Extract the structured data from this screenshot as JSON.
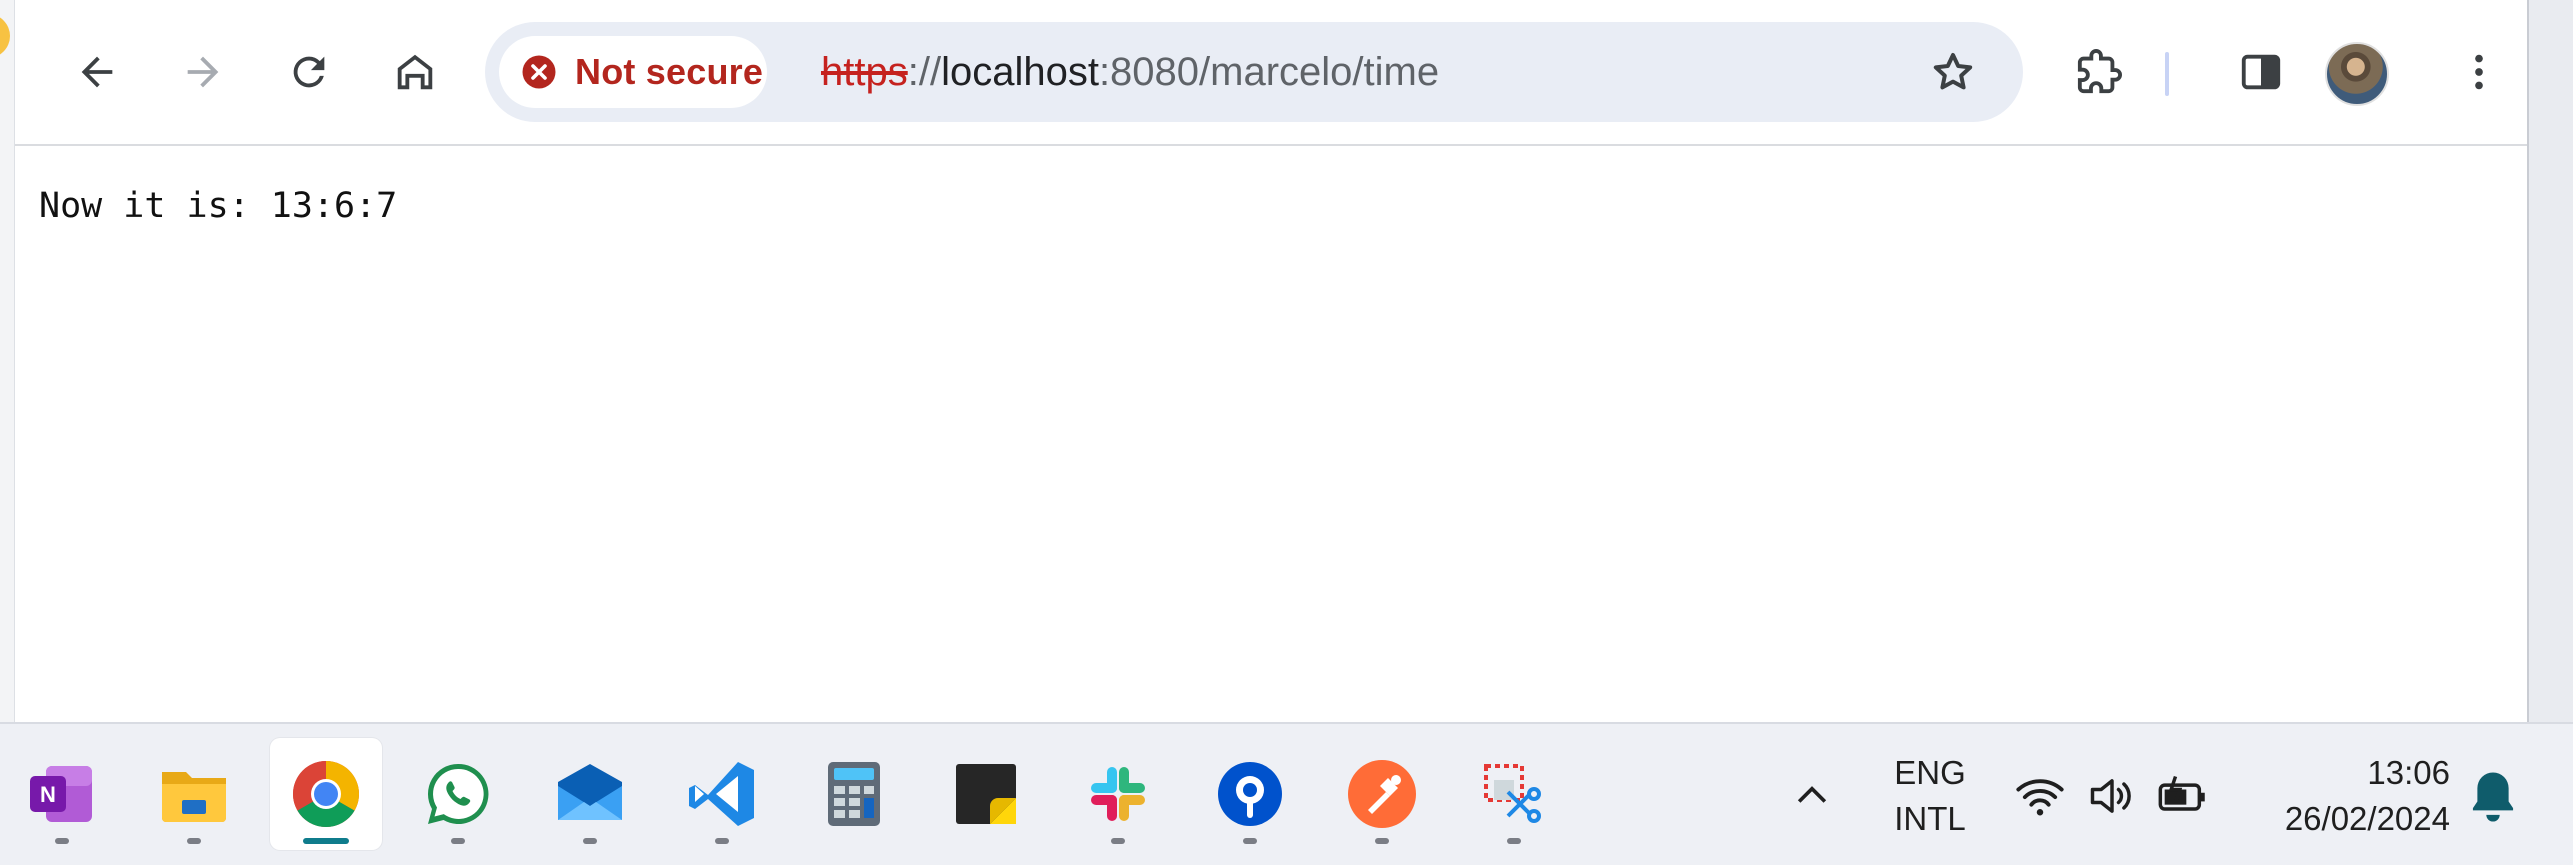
{
  "browser": {
    "nav": {
      "back_icon": "arrow-left-icon",
      "forward_icon": "arrow-right-icon",
      "reload_icon": "reload-icon",
      "home_icon": "home-icon"
    },
    "omnibox": {
      "security_label": "Not secure",
      "url_scheme": "https",
      "url_separator": "://",
      "url_host": "localhost",
      "url_rest": ":8080/marcelo/time"
    },
    "toolbar_icons": [
      "bookmark-star-icon",
      "extensions-puzzle-icon",
      "side-panel-icon",
      "profile-avatar",
      "more-menu-icon"
    ]
  },
  "page": {
    "text": "Now it is: 13:6:7"
  },
  "taskbar": {
    "apps": [
      {
        "name": "OneNote",
        "icon": "onenote-icon",
        "active": false
      },
      {
        "name": "File Explorer",
        "icon": "folder-icon",
        "active": false
      },
      {
        "name": "Google Chrome",
        "icon": "chrome-icon",
        "active": true
      },
      {
        "name": "WhatsApp",
        "icon": "whatsapp-icon",
        "active": false
      },
      {
        "name": "Mail",
        "icon": "mail-icon",
        "active": false
      },
      {
        "name": "Visual Studio Code",
        "icon": "vscode-icon",
        "active": false
      },
      {
        "name": "Calculator",
        "icon": "calculator-icon",
        "active": false
      },
      {
        "name": "Sticky Notes",
        "icon": "sticky-notes-icon",
        "active": false
      },
      {
        "name": "Slack",
        "icon": "slack-icon",
        "active": false
      },
      {
        "name": "Sourcetree",
        "icon": "sourcetree-icon",
        "active": false
      },
      {
        "name": "Postman",
        "icon": "postman-icon",
        "active": false
      },
      {
        "name": "Snipping Tool",
        "icon": "snipping-tool-icon",
        "active": false
      }
    ],
    "tray": {
      "language_line1": "ENG",
      "language_line2": "INTL",
      "time": "13:06",
      "date": "26/02/2024"
    }
  },
  "colors": {
    "not_secure_red": "#b3261e",
    "omnibox_bg": "#e9edf5",
    "taskbar_bg": "#eef0f5",
    "active_indicator": "#0f7c8c"
  }
}
